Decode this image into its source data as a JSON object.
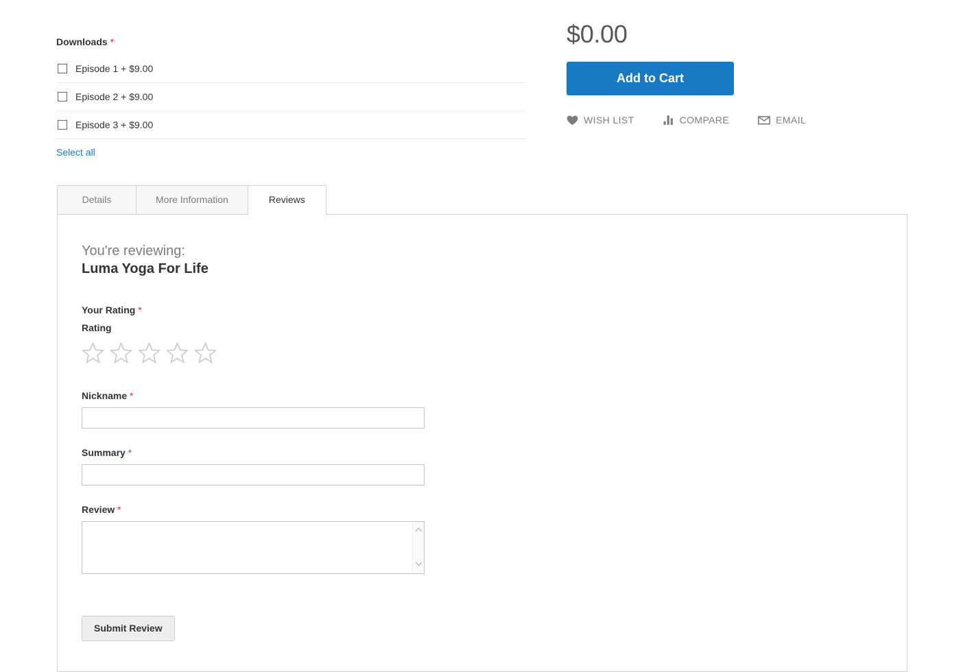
{
  "product_options": {
    "label": "Downloads",
    "required_mark": "*",
    "items": [
      {
        "label": "Episode 1 + $9.00",
        "checked": false
      },
      {
        "label": "Episode 2 + $9.00",
        "checked": false
      },
      {
        "label": "Episode 3 + $9.00",
        "checked": false
      }
    ],
    "select_all_label": "Select all"
  },
  "buy_box": {
    "price": "$0.00",
    "add_to_cart_label": "Add to Cart",
    "accent_color": "#1979c3",
    "actions": [
      {
        "icon": "heart-icon",
        "label": "WISH LIST"
      },
      {
        "icon": "compare-bars-icon",
        "label": "COMPARE"
      },
      {
        "icon": "envelope-icon",
        "label": "EMAIL"
      }
    ]
  },
  "tabs": [
    {
      "label": "Details",
      "active": false
    },
    {
      "label": "More Information",
      "active": false
    },
    {
      "label": "Reviews",
      "active": true
    }
  ],
  "review_form": {
    "reviewing_prefix": "You're reviewing:",
    "product_name": "Luma Yoga For Life",
    "rating": {
      "legend": "Your Rating",
      "required_mark": "*",
      "sub_label": "Rating",
      "stars_total": 5,
      "stars_selected": 0
    },
    "fields": [
      {
        "label": "Nickname",
        "required_mark": "*",
        "value": "",
        "placeholder": ""
      },
      {
        "label": "Summary",
        "required_mark": "*",
        "value": "",
        "placeholder": ""
      },
      {
        "label": "Review",
        "required_mark": "*",
        "value": "",
        "placeholder": ""
      }
    ],
    "submit_label": "Submit Review"
  }
}
